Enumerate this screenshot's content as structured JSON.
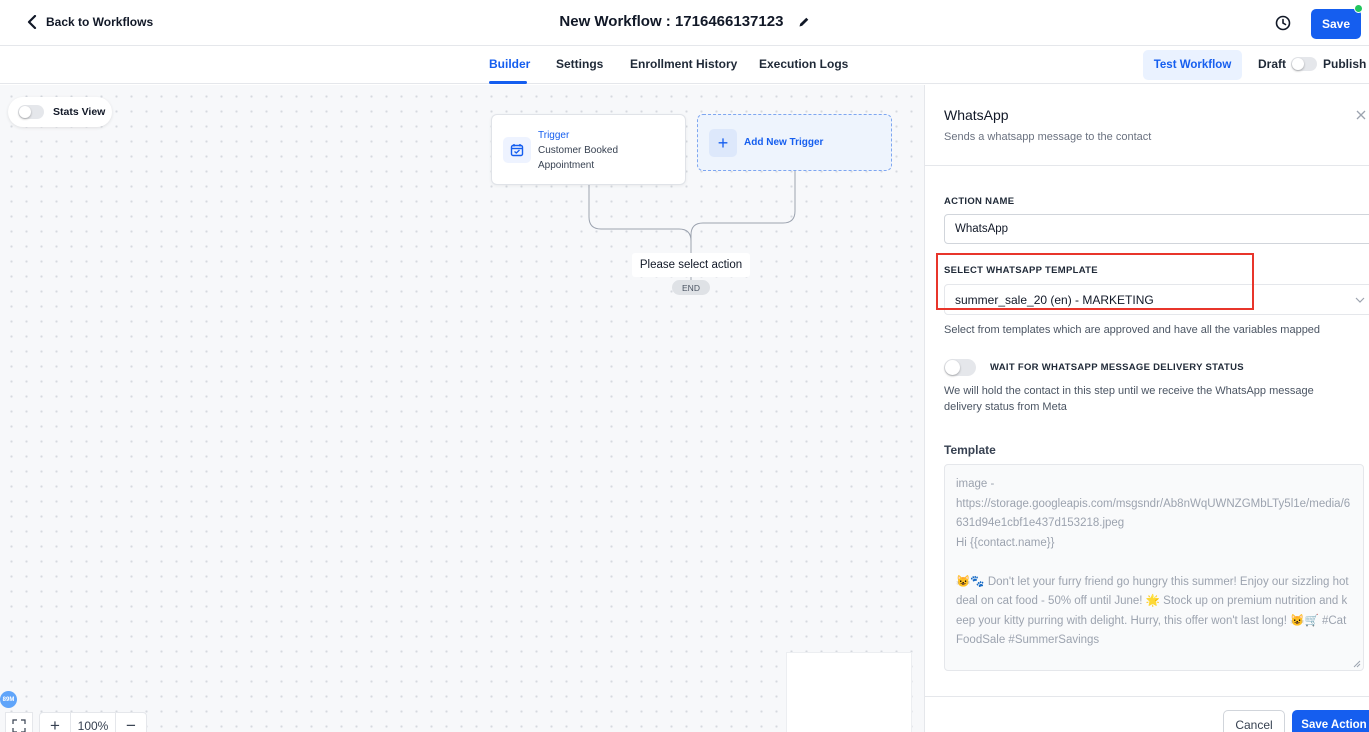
{
  "header": {
    "back_label": "Back to Workflows",
    "title": "New Workflow : 1716466137123",
    "save_label": "Save"
  },
  "tabs": [
    {
      "label": "Builder",
      "active": true
    },
    {
      "label": "Settings",
      "active": false
    },
    {
      "label": "Enrollment History",
      "active": false
    },
    {
      "label": "Execution Logs",
      "active": false
    }
  ],
  "toolbar": {
    "test_label": "Test Workflow",
    "draft_label": "Draft",
    "publish_label": "Publish",
    "published": false
  },
  "canvas": {
    "stats_view_label": "Stats View",
    "stats_view_on": false,
    "trigger": {
      "header": "Trigger",
      "name": "Customer Booked Appointment"
    },
    "add_trigger_label": "Add New Trigger",
    "select_action_label": "Please select action",
    "end_label": "END",
    "zoom_level": "100%",
    "avatar_text": "89M"
  },
  "panel": {
    "title": "WhatsApp",
    "subtitle": "Sends a whatsapp message to the contact",
    "action_name_label": "ACTION NAME",
    "action_name_value": "WhatsApp",
    "template_select_label": "SELECT WHATSAPP TEMPLATE",
    "template_select_value": "summer_sale_20 (en) - MARKETING",
    "template_helper": "Select from templates which are approved and have all the variables mapped",
    "wait_label": "WAIT FOR WHATSAPP MESSAGE DELIVERY STATUS",
    "wait_on": false,
    "wait_helper": "We will hold the contact in this step until we receive the WhatsApp message delivery status from Meta",
    "template_label": "Template",
    "template_body": "image -\nhttps://storage.googleapis.com/msgsndr/Ab8nWqUWNZGMbLTy5l1e/media/6631d94e1cbf1e437d153218.jpeg\nHi {{contact.name}}\n\n😺🐾 Don't let your furry friend go hungry this summer! Enjoy our sizzling hot deal on cat food - 50% off until June! 🌟 Stock up on premium nutrition and keep your kitty purring with delight. Hurry, this offer won't last long! 😺🛒 #CatFoodSale #SummerSavings",
    "cancel_label": "Cancel",
    "save_action_label": "Save Action"
  },
  "colors": {
    "primary": "#155eef",
    "highlight_box": "#e8352b",
    "status_dot": "#22c55e"
  }
}
